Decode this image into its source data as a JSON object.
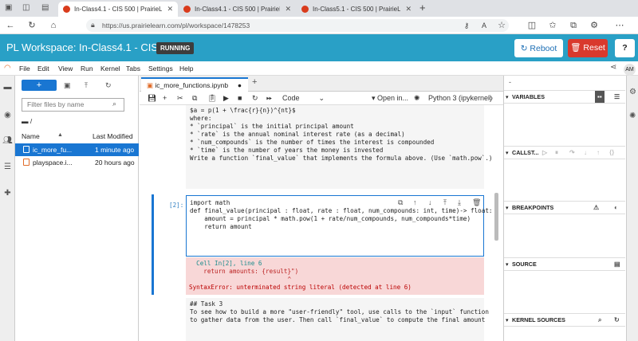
{
  "browser": {
    "tabs": [
      {
        "label": "In-Class4.1 - CIS 500 | PrairieLea"
      },
      {
        "label": "In-Class4.1 - CIS 500 | PrairieLea"
      },
      {
        "label": "In-Class5.1 - CIS 500 | PrairieLea"
      }
    ],
    "url": "https://us.prairielearn.com/pl/workspace/1478253"
  },
  "pl_header": {
    "title": "PL Workspace: In-Class4.1 - CIS 500",
    "status": "RUNNING",
    "reboot_label": "Reboot",
    "reset_label": "Reset",
    "help_label": "?"
  },
  "menubar": {
    "items": [
      "File",
      "Edit",
      "View",
      "Run",
      "Kernel",
      "Tabs",
      "Settings",
      "Help"
    ],
    "avatar": "AM"
  },
  "file_browser": {
    "filter_placeholder": "Filter files by name",
    "breadcrumb": "/",
    "col_name": "Name",
    "col_modified": "Last Modified",
    "files": [
      {
        "name": "ic_more_fu...",
        "modified": "1 minute ago",
        "selected": true
      },
      {
        "name": "playspace.i...",
        "modified": "20 hours ago",
        "selected": false
      }
    ]
  },
  "notebook": {
    "tab_label": "ic_more_functions.ipynb",
    "cell_type": "Code",
    "open_in": "Open in...",
    "kernel": "Python 3 (ipykernel)",
    "md_top_lines": [
      "$a = p(1 + \\frac{r}{n})^{nt}$",
      "",
      "where:",
      "* `principal` is the initial principal amount",
      "* `rate` is the annual nominal interest rate (as a decimal)",
      "* `num_compounds` is the number of times the interest is compounded",
      "* `time` is the number of years the money is invested",
      "",
      "Write a function `final_value` that implements the formula above. (Use `math.pow`.)"
    ],
    "code_prompt": "[2]:",
    "code_lines": [
      "import math",
      "",
      "def final_value(principal : float, rate : float, num_compounds: int, time)-> float:",
      "",
      "    amount = principal * math.pow(1 + rate/num_compounds, num_compounds*time)",
      "    return amount"
    ],
    "error_lines": [
      "  Cell In[2], line 6",
      "    return amounts: {result}\")",
      "                           ^",
      "SyntaxError: unterminated string literal (detected at line 6)"
    ],
    "md_bottom_lines": [
      "## Task 3",
      "",
      "To see how to build a more \"user-friendly\" tool, use calls to the `input` function",
      "to gather data from the user. Then call `final_value` to compute the final amount"
    ]
  },
  "debugger": {
    "sections": [
      "VARIABLES",
      "CALLST...",
      "BREAKPOINTS",
      "SOURCE",
      "KERNEL SOURCES"
    ]
  }
}
